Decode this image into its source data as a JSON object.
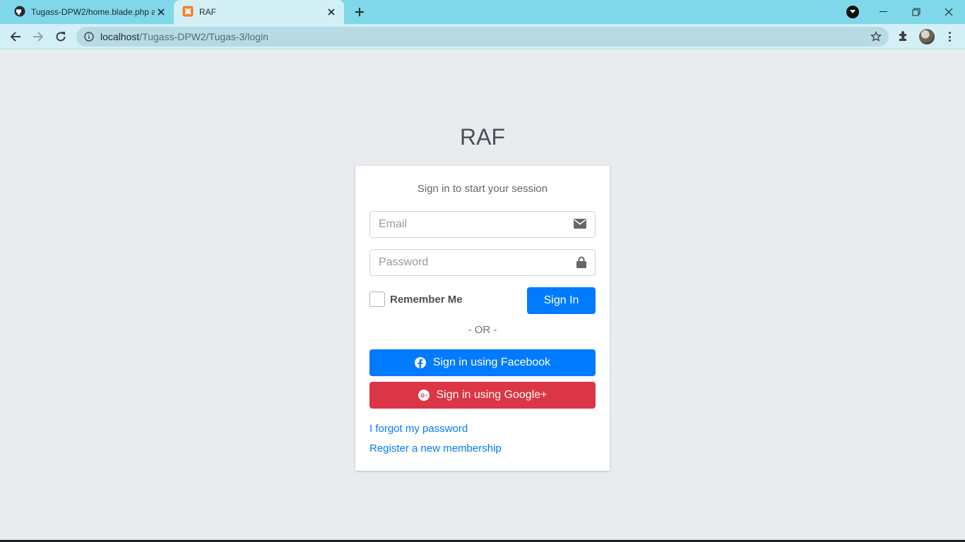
{
  "browser": {
    "tabs": [
      {
        "title": "Tugass-DPW2/home.blade.php a",
        "icon": "github-icon",
        "active": false
      },
      {
        "title": "RAF",
        "icon": "xampp-icon",
        "active": true
      }
    ],
    "address": {
      "host": "localhost",
      "path": "/Tugass-DPW2/Tugas-3/login"
    }
  },
  "page": {
    "logo": "RAF",
    "login_message": "Sign in to start your session",
    "email_placeholder": "Email",
    "password_placeholder": "Password",
    "remember_label": "Remember Me",
    "sign_in_label": "Sign In",
    "or_text": "- OR -",
    "facebook_label": "Sign in using Facebook",
    "google_label": "Sign in using Google+",
    "forgot_link": "I forgot my password",
    "register_link": "Register a new membership"
  },
  "colors": {
    "primary": "#007bff",
    "danger": "#dc3545",
    "page_bg": "#e9ecef",
    "tabstrip_bg": "#7fd8e9"
  }
}
